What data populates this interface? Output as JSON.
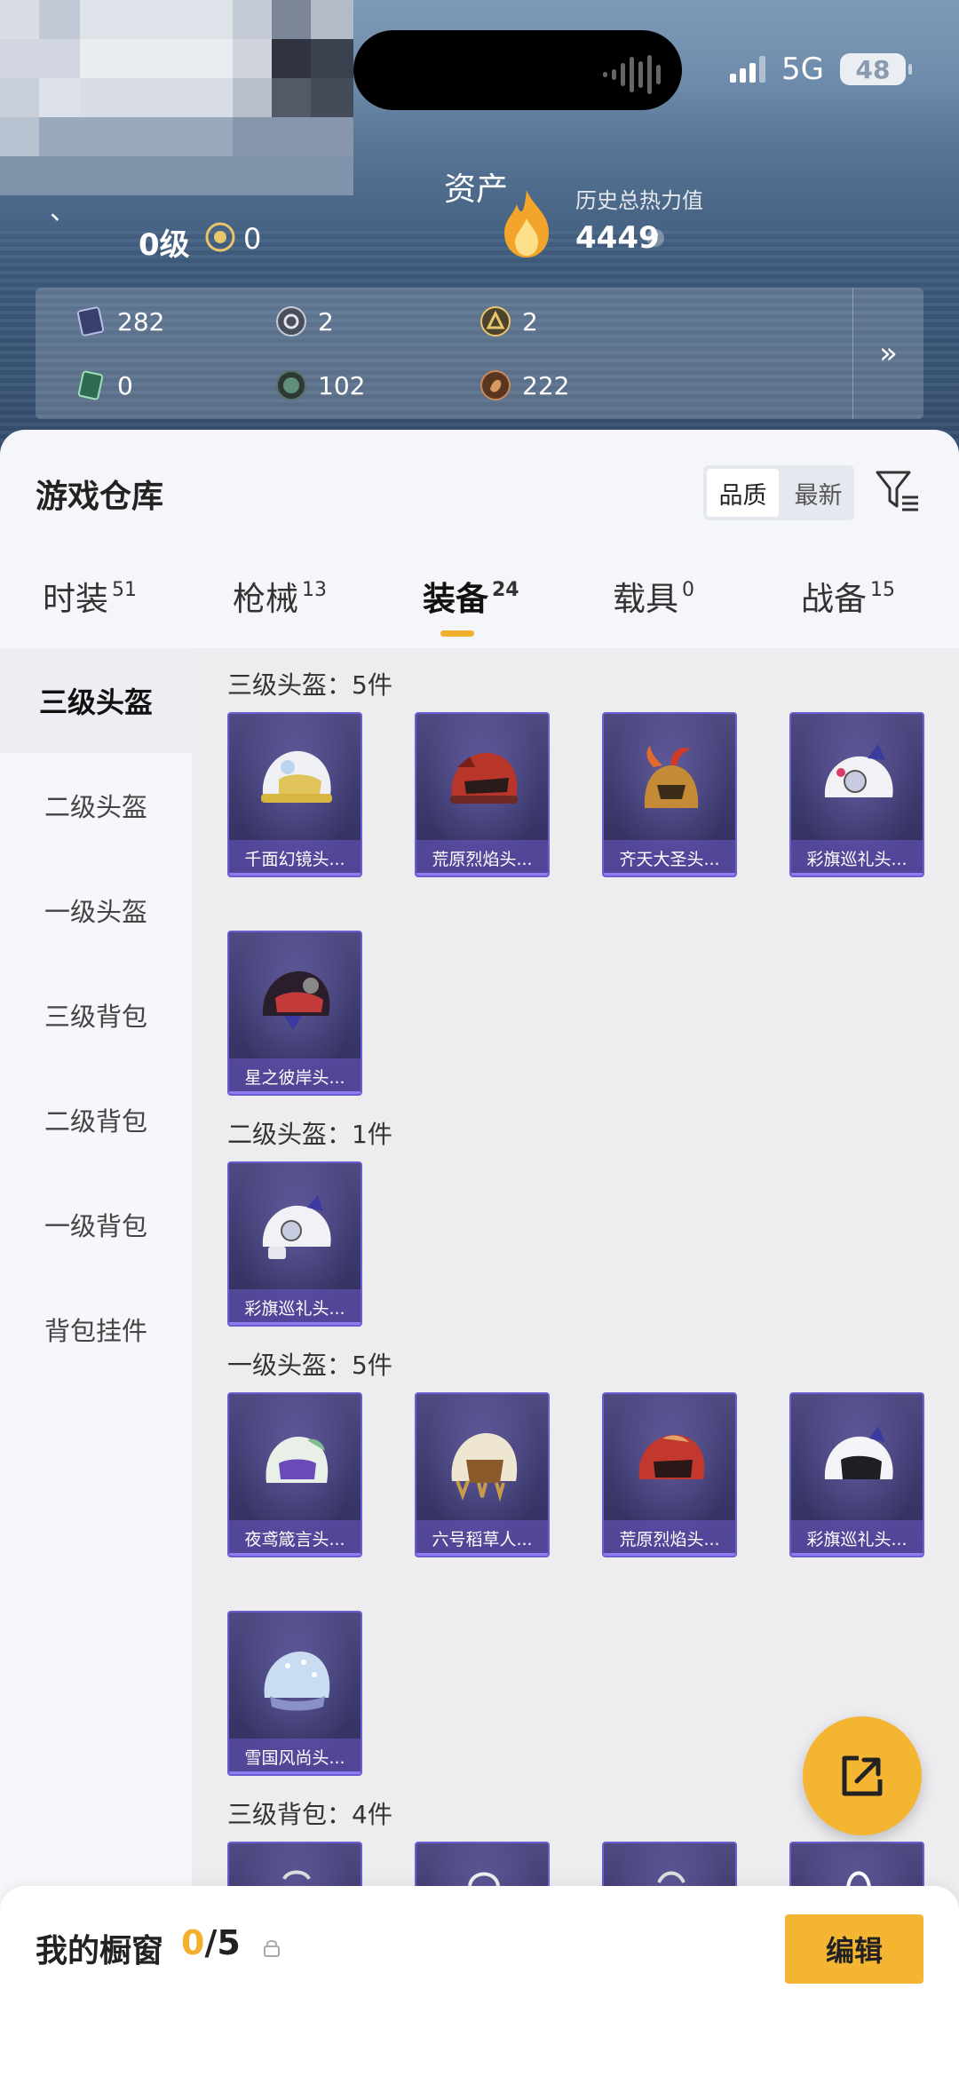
{
  "status_bar": {
    "network": "5G",
    "battery": "48"
  },
  "header": {
    "title": "资产",
    "level": "0级",
    "level_value": "0",
    "heat_label": "历史总热力值",
    "heat_value": "4449",
    "heat_help": "?",
    "more_icon": "double-chevron-right-icon",
    "assets": [
      {
        "icon": "card-icon",
        "value": "282"
      },
      {
        "icon": "silver-coin-icon",
        "value": "2"
      },
      {
        "icon": "gold-coin-icon",
        "value": "2"
      },
      {
        "icon": "green-ticket-icon",
        "value": "0"
      },
      {
        "icon": "green-orb-icon",
        "value": "102"
      },
      {
        "icon": "bronze-coin-icon",
        "value": "222"
      }
    ]
  },
  "warehouse": {
    "title": "游戏仓库",
    "sort_options": [
      "品质",
      "最新"
    ],
    "active_sort": "品质",
    "filter_icon": "filter-icon"
  },
  "tabs": [
    {
      "label": "时装",
      "count": "51"
    },
    {
      "label": "枪械",
      "count": "13"
    },
    {
      "label": "装备",
      "count": "24"
    },
    {
      "label": "载具",
      "count": "0"
    },
    {
      "label": "战备",
      "count": "15"
    }
  ],
  "active_tab": "装备",
  "sidebar": [
    "三级头盔",
    "二级头盔",
    "一级头盔",
    "三级背包",
    "二级背包",
    "一级背包",
    "背包挂件"
  ],
  "active_sidebar": "三级头盔",
  "sections": [
    {
      "title": "三级头盔：5件",
      "items": [
        "千面幻镜头...",
        "荒原烈焰头...",
        "齐天大圣头...",
        "彩旗巡礼头...",
        "星之彼岸头..."
      ]
    },
    {
      "title": "二级头盔：1件",
      "items": [
        "彩旗巡礼头..."
      ]
    },
    {
      "title": "一级头盔：5件",
      "items": [
        "夜鸢箴言头...",
        "六号稻草人...",
        "荒原烈焰头...",
        "彩旗巡礼头...",
        "雪国风尚头..."
      ]
    },
    {
      "title": "三级背包：4件",
      "items": [
        "",
        "",
        "",
        ""
      ]
    }
  ],
  "showcase": {
    "title": "我的橱窗",
    "current": "0",
    "total": "/5",
    "edit_label": "编辑"
  },
  "fab_icon": "share-icon",
  "colors": {
    "accent": "#f4b532",
    "card_purple": "#3d3a6e",
    "card_border": "#6a5fd0"
  }
}
